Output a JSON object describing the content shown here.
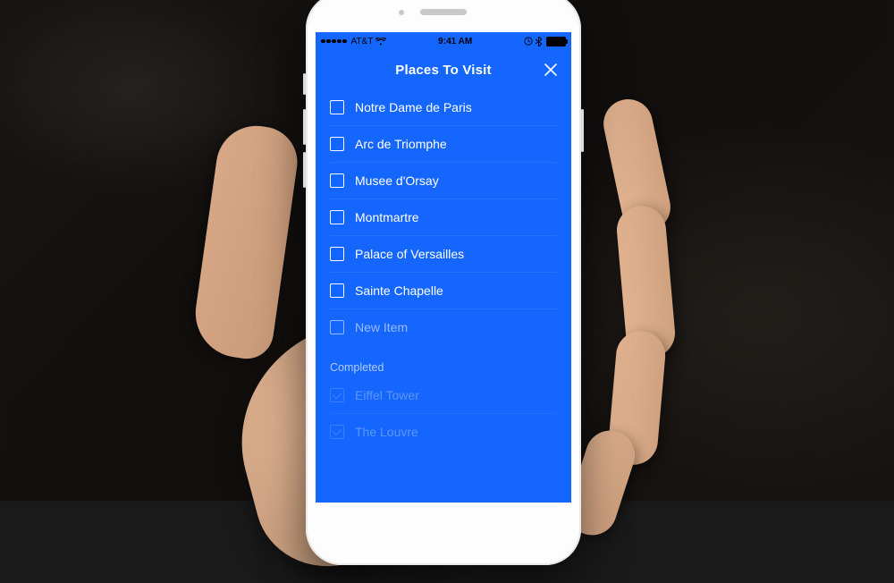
{
  "statusbar": {
    "carrier": "AT&T",
    "wifi": "wifi-icon",
    "time": "9:41 AM",
    "bt": "bluetooth-icon"
  },
  "header": {
    "title": "Places To Visit"
  },
  "todo": [
    {
      "label": "Notre Dame de Paris",
      "done": false
    },
    {
      "label": "Arc de Triomphe",
      "done": false
    },
    {
      "label": "Musee d'Orsay",
      "done": false
    },
    {
      "label": "Montmartre",
      "done": false
    },
    {
      "label": "Palace of Versailles",
      "done": false
    },
    {
      "label": "Sainte Chapelle",
      "done": false
    }
  ],
  "new_item_placeholder": "New Item",
  "completed_label": "Completed",
  "completed": [
    {
      "label": "Eiffel Tower",
      "done": true
    },
    {
      "label": "The Louvre",
      "done": true
    }
  ],
  "colors": {
    "accent": "#1566ff"
  }
}
